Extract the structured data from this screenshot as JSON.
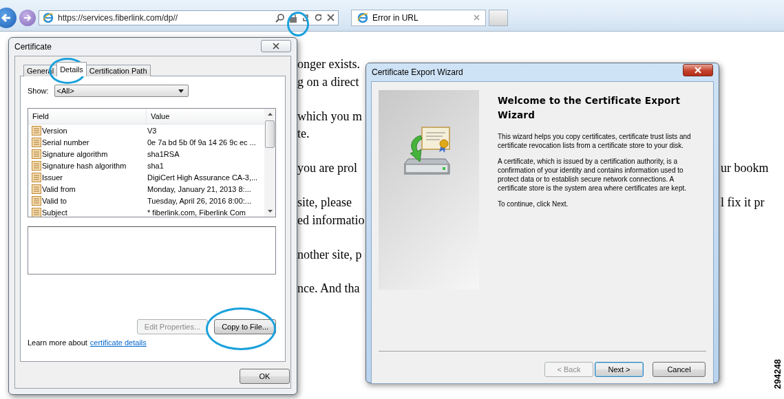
{
  "browser": {
    "address": "https://services.fiberlink.com/dp//",
    "lock_circled": true,
    "tabs": [
      {
        "title": "Error in URL",
        "selected": true
      }
    ]
  },
  "page_lines": [
    {
      "left": "onger exists."
    },
    {
      "left": "g on a direct"
    },
    {
      "left": "which you m"
    },
    {
      "left": "te."
    },
    {
      "left": "you are prol",
      "right": "ur bookm"
    },
    {
      "left": "site, please",
      "right": "l fix it pr"
    },
    {
      "left": "ed informatio"
    },
    {
      "left": "nother site, p"
    },
    {
      "left": "nce. And tha"
    }
  ],
  "certificate_dialog": {
    "title": "Certificate",
    "tabs": [
      {
        "label": "General",
        "selected": false,
        "circled": false
      },
      {
        "label": "Details",
        "selected": true,
        "circled": true
      },
      {
        "label": "Certification Path",
        "selected": false,
        "circled": false
      }
    ],
    "show_label": "Show:",
    "show_value": "<All>",
    "columns": [
      "Field",
      "Value"
    ],
    "rows": [
      {
        "field": "Version",
        "value": "V3"
      },
      {
        "field": "Serial number",
        "value": "0e 7a bd 5b 0f 9a 14 26 9c ec ..."
      },
      {
        "field": "Signature algorithm",
        "value": "sha1RSA"
      },
      {
        "field": "Signature hash algorithm",
        "value": "sha1"
      },
      {
        "field": "Issuer",
        "value": "DigiCert High Assurance CA-3,..."
      },
      {
        "field": "Valid from",
        "value": "Monday, January 21, 2013 8:..."
      },
      {
        "field": "Valid to",
        "value": "Tuesday, April 26, 2016 8:00:..."
      },
      {
        "field": "Subject",
        "value": "* fiberlink.com, Fiberlink Com"
      }
    ],
    "buttons": [
      {
        "label": "Edit Properties...",
        "disabled": true,
        "circled": false
      },
      {
        "label": "Copy to File...",
        "disabled": false,
        "circled": true
      }
    ],
    "learn_more": "Learn more about",
    "link": "certificate details",
    "ok": "OK"
  },
  "wizard": {
    "title": "Certificate Export Wizard",
    "heading": "Welcome to the Certificate Export Wizard",
    "paragraphs": [
      "This wizard helps you copy certificates, certificate trust lists and certificate revocation lists from a certificate store to your disk.",
      "A certificate, which is issued by a certification authority, is a confirmation of your identity and contains information used to protect data or to establish secure network connections. A certificate store is the system area where certificates are kept.",
      "To continue, click Next."
    ],
    "buttons": [
      {
        "label": "< Back",
        "disabled": true,
        "default": false
      },
      {
        "label": "Next >",
        "disabled": false,
        "default": true
      },
      {
        "label": "Cancel",
        "disabled": false,
        "default": false
      }
    ]
  },
  "figure_number": "294248"
}
